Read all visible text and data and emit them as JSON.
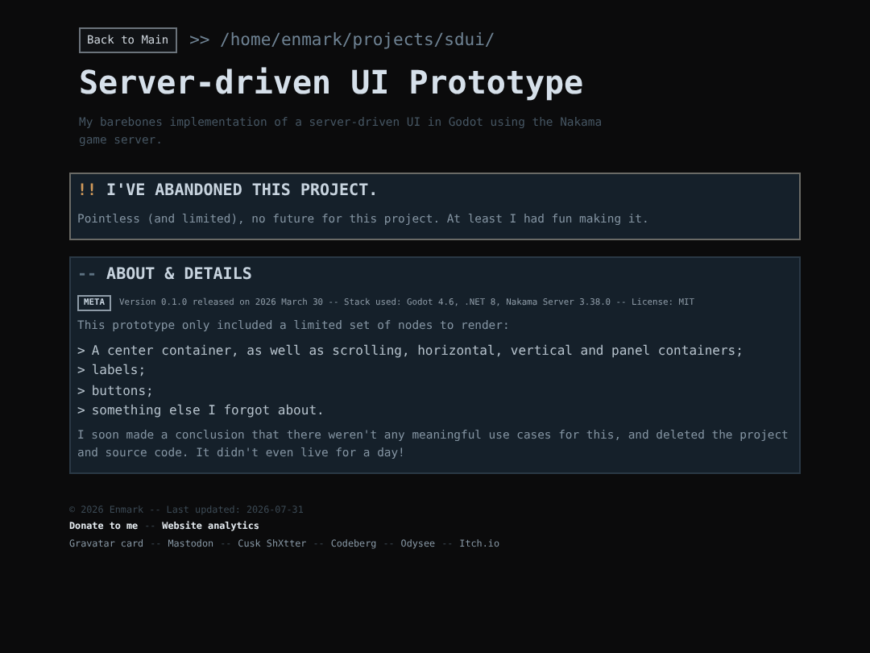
{
  "header": {
    "back_button": "Back to Main",
    "path": ">> /home/enmark/projects/sdui/",
    "title": "Server-driven UI Prototype",
    "subtitle": "My barebones implementation of a server-driven UI in Godot using the Nakama game server."
  },
  "notice": {
    "marker": "!!",
    "heading": "I'VE ABANDONED THIS PROJECT.",
    "text": "Pointless (and limited), no future for this project. At least I had fun making it."
  },
  "about": {
    "marker": "--",
    "heading": "ABOUT & DETAILS",
    "meta_tag": "META",
    "meta": "Version 0.1.0 released on 2026 March 30 -- Stack used: Godot 4.6, .NET 8, Nakama Server 3.38.0 -- License: MIT",
    "intro": "This prototype only included a limited set of nodes to render:",
    "list": [
      {
        "bullet": ">",
        "text": "A center container, as well as scrolling, horizontal, vertical and panel containers;"
      },
      {
        "bullet": ">",
        "text": "labels;"
      },
      {
        "bullet": ">",
        "text": "buttons;"
      },
      {
        "bullet": ">",
        "text": "something else I forgot about."
      }
    ],
    "conclusion": "I soon made a conclusion that there weren't any meaningful use cases for this, and deleted the project and source code. It didn't even live for a day!"
  },
  "footer": {
    "copyright": "© 2026 Enmark -- Last updated: 2026-07-31",
    "separator": "--",
    "link_rows": [
      {
        "kind": "primary",
        "links": [
          "Donate to me",
          "Website analytics"
        ]
      },
      {
        "kind": "secondary",
        "links": [
          "Gravatar card",
          "Mastodon",
          "Cusk ShXtter",
          "Codeberg",
          "Odysee",
          "Itch.io"
        ]
      }
    ]
  }
}
